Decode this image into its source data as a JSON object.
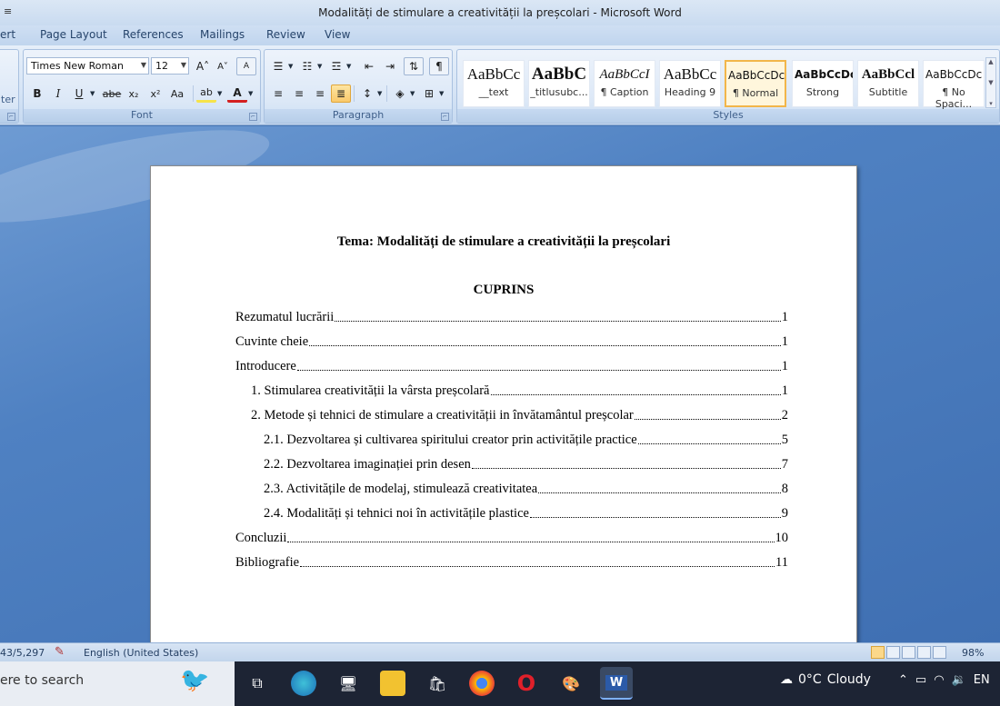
{
  "window": {
    "title": "Modalități de stimulare a creativității la preșcolari - Microsoft Word",
    "quick_access": "≡"
  },
  "ribbon_tabs": [
    {
      "label": "ert"
    },
    {
      "label": "Page Layout"
    },
    {
      "label": "References"
    },
    {
      "label": "Mailings"
    },
    {
      "label": "Review"
    },
    {
      "label": "View"
    }
  ],
  "ribbon": {
    "clipboard_fragment": "ter",
    "font_group": {
      "label": "Font",
      "font_name": "Times New Roman",
      "font_size": "12",
      "buttons": {
        "bold": "B",
        "italic": "I",
        "underline": "U",
        "strikethrough": "abe",
        "subscript": "x₂",
        "superscript": "x²",
        "change_case": "Aa",
        "grow": "A˄",
        "shrink": "A˅",
        "clear": "A",
        "highlight": "ab",
        "font_color": "A"
      }
    },
    "paragraph_group": {
      "label": "Paragraph",
      "show_marks": "¶"
    },
    "styles_group": {
      "label": "Styles",
      "items": [
        {
          "sample": "AaBbCc",
          "name": "__text"
        },
        {
          "sample": "AaBbC",
          "name": "_titlusubc..."
        },
        {
          "sample": "AaBbCcI",
          "name": "¶ Caption"
        },
        {
          "sample": "AaBbCc",
          "name": "Heading 9"
        },
        {
          "sample": "AaBbCcDc",
          "name": "¶ Normal"
        },
        {
          "sample": "AaBbCcDc",
          "name": "Strong"
        },
        {
          "sample": "AaBbCcl",
          "name": "Subtitle"
        },
        {
          "sample": "AaBbCcDc",
          "name": "¶ No Spaci..."
        }
      ],
      "selected_index": 4
    }
  },
  "document": {
    "title": "Tema: Modalități de stimulare a creativității la preșcolari",
    "toc_heading": "CUPRINS",
    "toc": [
      {
        "text": "Rezumatul lucrării",
        "page": "1",
        "level": 0
      },
      {
        "text": "Cuvinte cheie",
        "page": "1",
        "level": 0
      },
      {
        "text": "Introducere",
        "page": "1",
        "level": 0
      },
      {
        "text": "1. Stimularea creativității la vârsta preșcolară",
        "page": "1",
        "level": 1
      },
      {
        "text": "2. Metode și tehnici de stimulare a creativității in învătamântul preșcolar",
        "page": "2",
        "level": 1
      },
      {
        "text": "2.1. Dezvoltarea și cultivarea spiritului creator prin activitățile practice",
        "page": "5",
        "level": 2
      },
      {
        "text": "2.2. Dezvoltarea imaginației prin desen",
        "page": "7",
        "level": 2
      },
      {
        "text": "2.3. Activitățile de modelaj, stimulează creativitatea",
        "page": "8",
        "level": 2
      },
      {
        "text": "2.4. Modalități și tehnici noi în activitățile plastice",
        "page": "9",
        "level": 2
      },
      {
        "text": "Concluzii",
        "page": "10",
        "level": 0
      },
      {
        "text": "Bibliografie",
        "page": "11",
        "level": 0
      }
    ]
  },
  "statusbar": {
    "words": "43/5,297",
    "language": "English (United States)",
    "zoom": "98%"
  },
  "taskbar": {
    "search_text": "ere to search",
    "weather_temp": "0°C",
    "weather_desc": "Cloudy",
    "lang": "EN"
  }
}
